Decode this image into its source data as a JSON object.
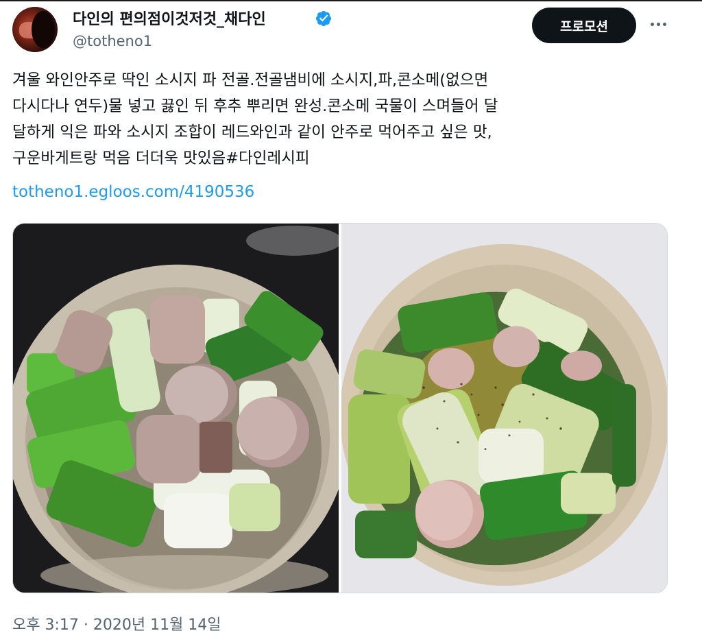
{
  "tweet": {
    "display_name": "다인의 편의점이것저것_채다인",
    "handle": "@totheno1",
    "promo_label": "프로모션",
    "text_lines": [
      "겨울 와인안주로 딱인 소시지 파 전골.전골냄비에 소시지,파,콘소메(없으면",
      "다시다나 연두)물 넣고 끓인 뒤 후추 뿌리면 완성.콘소메 국물이 스며들어 달",
      "달하게 익은 파와 소시지 조합이 레드와인과 같이 안주로 먹어주고 싶은 맛,",
      "구운바게트랑 먹음 더더욱 맛있음#다인레시피"
    ],
    "link": "totheno1.egloos.com/4190536",
    "timestamp": "오후 3:17 · 2020년 11월 14일"
  },
  "icons": {
    "verified": "verified-badge-icon",
    "more": "more-options-icon"
  },
  "colors": {
    "text": "#0f1419",
    "secondary": "#536471",
    "link": "#1d9bf0",
    "verified": "#1d9bf0",
    "button_bg": "#0f1419"
  }
}
